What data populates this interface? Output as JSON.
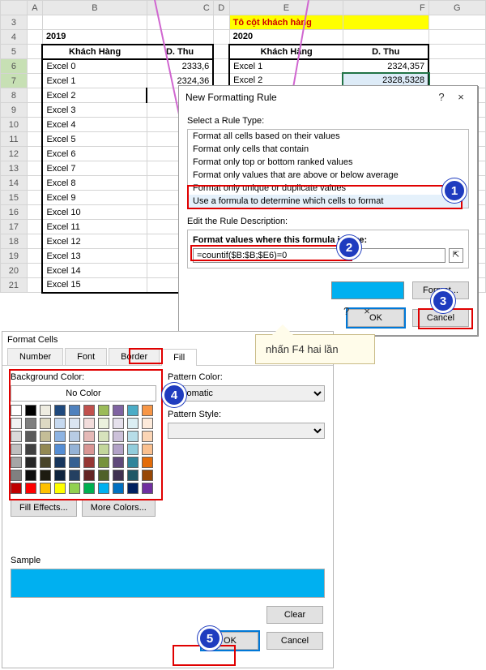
{
  "columns": [
    "A",
    "B",
    "C",
    "D",
    "E",
    "F",
    "G"
  ],
  "rows_visible": [
    "3",
    "4",
    "5",
    "6",
    "7",
    "8",
    "9",
    "10",
    "11",
    "12",
    "13",
    "14",
    "15",
    "16",
    "17",
    "18",
    "19",
    "20",
    "21"
  ],
  "grid": {
    "E3": "Tô cột khách hàng",
    "B4": "2019",
    "E4": "2020",
    "B5": "Khách Hàng",
    "C5": "D. Thu",
    "E5": "Khách Hàng",
    "F5": "D. Thu",
    "B6": "Excel 0",
    "C6": "2333,6",
    "E6": "Excel 1",
    "F6": "2324,357",
    "B7": "Excel 1",
    "C7": "2324,36",
    "E7": "Excel 2",
    "F7": "2328,5328",
    "B8": "Excel 2",
    "B9": "Excel 3",
    "B10": "Excel 4",
    "B11": "Excel 5",
    "B12": "Excel 6",
    "B13": "Excel 7",
    "B14": "Excel 8",
    "B15": "Excel 9",
    "B16": "Excel 10",
    "B17": "Excel 11",
    "B18": "Excel 12",
    "B19": "Excel 13",
    "B20": "Excel 14",
    "B21": "Excel 15"
  },
  "nfr": {
    "title": "New Formatting Rule",
    "help": "?",
    "close": "×",
    "select_label": "Select a Rule Type:",
    "items": [
      "Format all cells based on their values",
      "Format only cells that contain",
      "Format only top or bottom ranked values",
      "Format only values that are above or below average",
      "Format only unique or duplicate values",
      "Use a formula to determine which cells to format"
    ],
    "selected_index": 5,
    "edit_label": "Edit the Rule Description:",
    "formula_label": "Format values where this formula is true:",
    "formula_value": "=countif($B:$B;$E6)=0",
    "ref_glyph": "⇱",
    "format_btn": "Format...",
    "ok": "OK",
    "cancel": "Cancel"
  },
  "fc": {
    "title": "Format Cells",
    "help": "?",
    "close": "×",
    "tabs": [
      "Number",
      "Font",
      "Border",
      "Fill"
    ],
    "active_tab": "Fill",
    "bg_label": "Background Color:",
    "no_color": "No Color",
    "pattern_color_label": "Pattern Color:",
    "pattern_color_value": "Automatic",
    "pattern_style_label": "Pattern Style:",
    "fill_effects": "Fill Effects...",
    "more_colors": "More Colors...",
    "sample_label": "Sample",
    "clear": "Clear",
    "ok": "OK",
    "cancel": "Cancel",
    "palette": [
      "#ffffff",
      "#000000",
      "#eeece1",
      "#1f497d",
      "#4f81bd",
      "#c0504d",
      "#9bbb59",
      "#8064a2",
      "#4bacc6",
      "#f79646",
      "#f2f2f2",
      "#7f7f7f",
      "#ddd9c3",
      "#c6d9f0",
      "#dbe5f1",
      "#f2dcdb",
      "#ebf1dd",
      "#e5e0ec",
      "#dbeef3",
      "#fdeada",
      "#d9d9d9",
      "#595959",
      "#c4bd97",
      "#8db3e2",
      "#b8cce4",
      "#e5b9b7",
      "#d7e3bc",
      "#ccc1d9",
      "#b7dde8",
      "#fbd5b5",
      "#bfbfbf",
      "#404040",
      "#938953",
      "#548dd4",
      "#95b3d7",
      "#d99694",
      "#c3d69b",
      "#b2a2c7",
      "#92cddc",
      "#fac08f",
      "#a6a6a6",
      "#262626",
      "#494429",
      "#17365d",
      "#366092",
      "#953734",
      "#76923c",
      "#5f497a",
      "#31859b",
      "#e36c09",
      "#808080",
      "#0d0d0d",
      "#1d1b10",
      "#0f243e",
      "#244061",
      "#632423",
      "#4f6128",
      "#3f3151",
      "#205867",
      "#974806",
      "#c00000",
      "#ff0000",
      "#ffc000",
      "#ffff00",
      "#92d050",
      "#00b050",
      "#00b0f0",
      "#0070c0",
      "#002060",
      "#7030a0"
    ]
  },
  "callout": {
    "text": "nhấn F4 hai lần"
  },
  "badges": {
    "b1": "1",
    "b2": "2",
    "b3": "3",
    "b4": "4",
    "b5": "5"
  }
}
